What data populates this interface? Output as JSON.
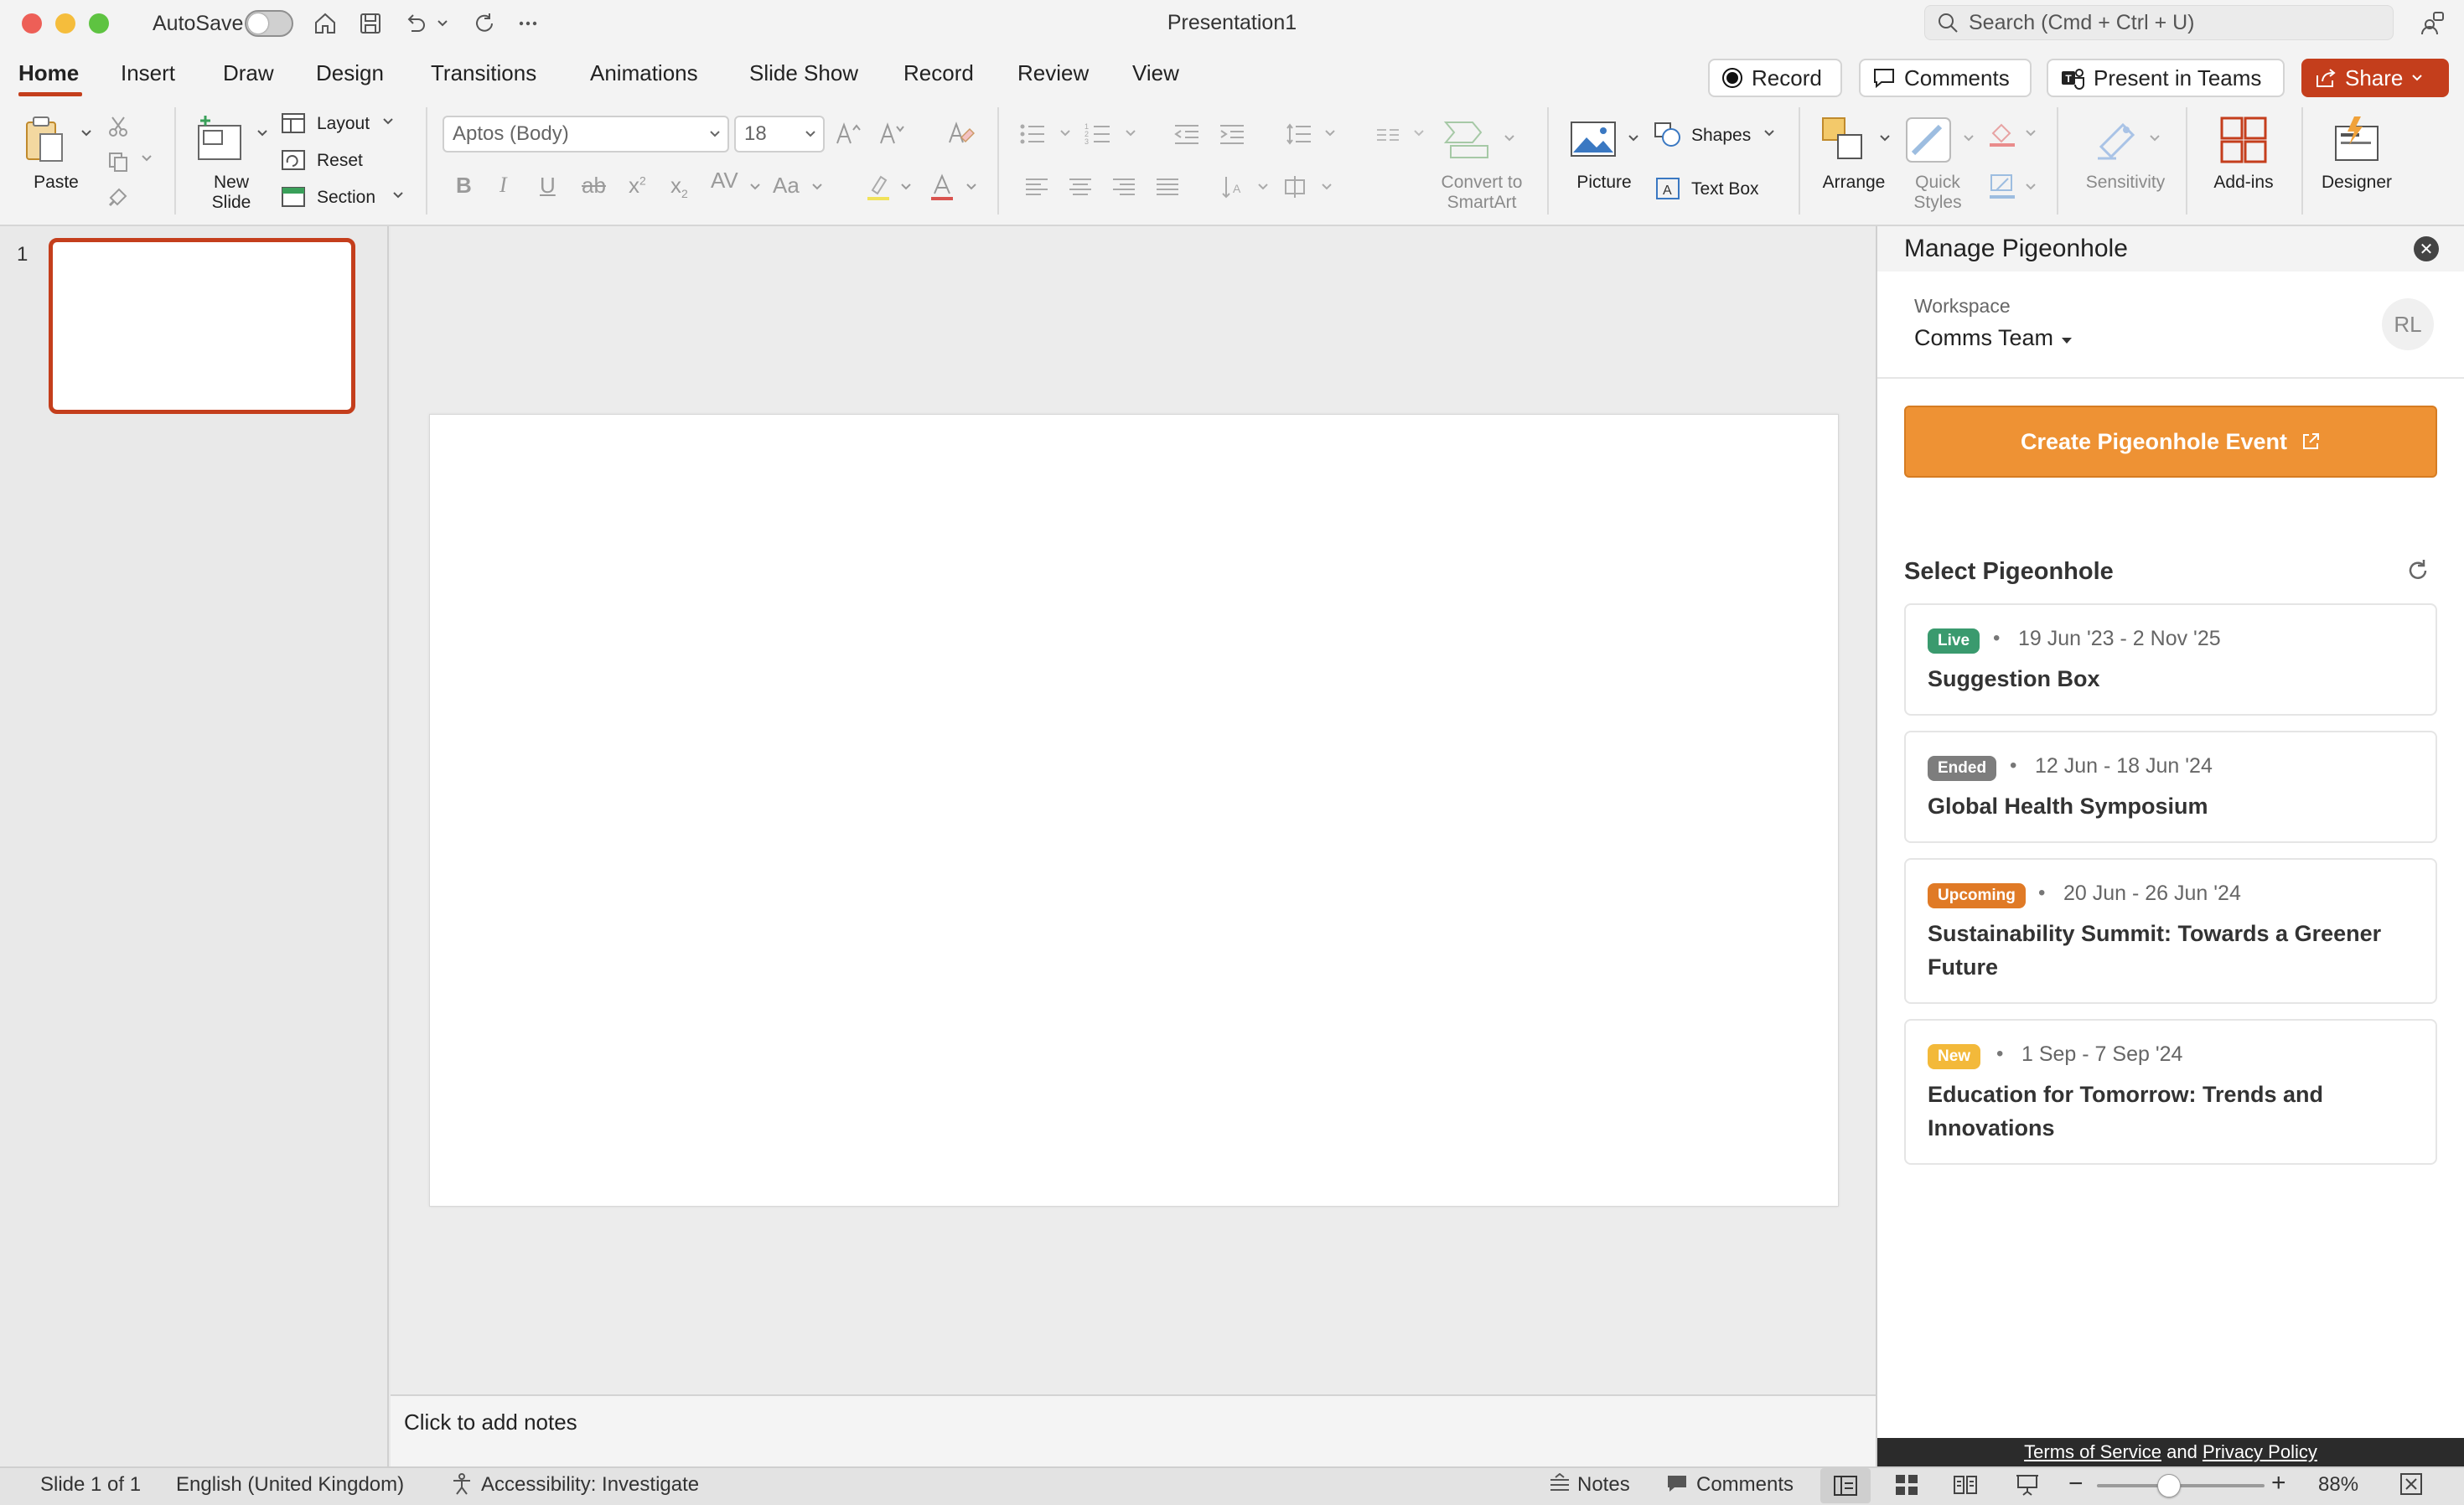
{
  "window": {
    "autosave_label": "AutoSave",
    "doc_title": "Presentation1",
    "search_placeholder": "Search (Cmd + Ctrl + U)"
  },
  "tabs": [
    "Home",
    "Insert",
    "Draw",
    "Design",
    "Transitions",
    "Animations",
    "Slide Show",
    "Record",
    "Review",
    "View"
  ],
  "top_buttons": {
    "record": "Record",
    "comments": "Comments",
    "present_in_teams": "Present in Teams",
    "share": "Share"
  },
  "ribbon": {
    "paste": "Paste",
    "new_slide_1": "New",
    "new_slide_2": "Slide",
    "layout": "Layout",
    "reset": "Reset",
    "section": "Section",
    "font_name": "Aptos (Body)",
    "font_size": "18",
    "convert_1": "Convert to",
    "convert_2": "SmartArt",
    "picture": "Picture",
    "shapes": "Shapes",
    "text_box": "Text Box",
    "arrange": "Arrange",
    "quick_styles_1": "Quick",
    "quick_styles_2": "Styles",
    "sensitivity": "Sensitivity",
    "add_ins": "Add-ins",
    "designer": "Designer"
  },
  "thumbnails": {
    "slide_number": "1"
  },
  "notes": {
    "placeholder": "Click to add notes"
  },
  "pane": {
    "title": "Manage Pigeonhole",
    "workspace_label": "Workspace",
    "workspace_value": "Comms Team",
    "avatar_initials": "RL",
    "create_button": "Create Pigeonhole Event",
    "select_title": "Select Pigeonhole",
    "events": [
      {
        "status": "Live",
        "dates": "19 Jun '23 - 2 Nov '25",
        "name": "Suggestion Box",
        "color": "#3a9a6e"
      },
      {
        "status": "Ended",
        "dates": "12 Jun - 18 Jun '24",
        "name": "Global Health Symposium",
        "color": "#7d7d7d"
      },
      {
        "status": "Upcoming",
        "dates": "20 Jun - 26 Jun '24",
        "name": "Sustainability Summit: Towards a Greener Future",
        "color": "#e07a26"
      },
      {
        "status": "New",
        "dates": "1 Sep - 7 Sep '24",
        "name": "Education for Tomorrow: Trends and Innovations",
        "color": "#f3b93a"
      }
    ],
    "footer_tos": "Terms of Service",
    "footer_and": "and",
    "footer_privacy": "Privacy Policy"
  },
  "status_bar": {
    "slide_info": "Slide 1 of 1",
    "language": "English (United Kingdom)",
    "accessibility": "Accessibility: Investigate",
    "notes": "Notes",
    "comments": "Comments",
    "zoom": "88%"
  },
  "colors": {
    "accent": "#c43e1c",
    "pigeonhole_orange": "#ee9234"
  }
}
